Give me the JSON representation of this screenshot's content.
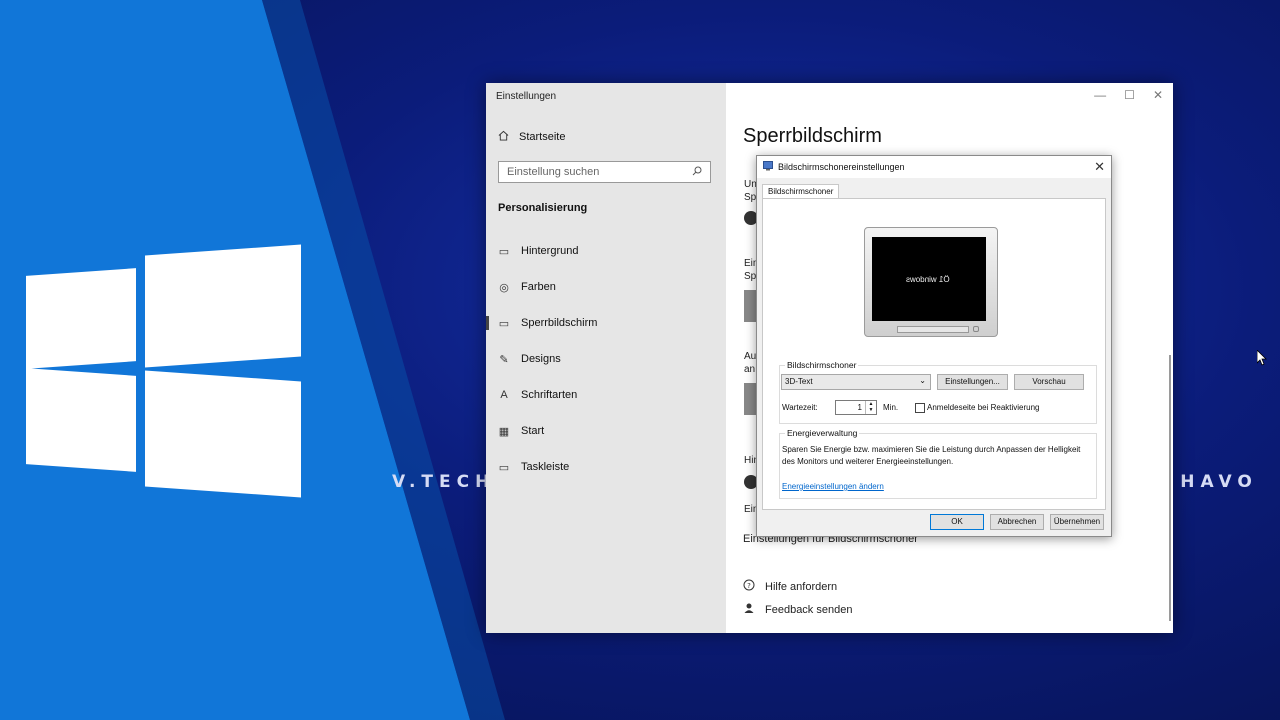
{
  "background": {
    "text_left": "V.TECHN",
    "text_right": "SHAVO",
    "colors": {
      "deep_blue": "#0b1c7a",
      "accent_blue": "#1176d8"
    }
  },
  "settings": {
    "app_title": "Einstellungen",
    "home_label": "Startseite",
    "search_placeholder": "Einstellung suchen",
    "section": "Personalisierung",
    "nav": [
      {
        "label": "Hintergrund",
        "icon": "picture-icon"
      },
      {
        "label": "Farben",
        "icon": "palette-icon"
      },
      {
        "label": "Sperrbildschirm",
        "icon": "lock-screen-icon",
        "active": true
      },
      {
        "label": "Designs",
        "icon": "brush-icon"
      },
      {
        "label": "Schriftarten",
        "icon": "font-icon"
      },
      {
        "label": "Start",
        "icon": "start-icon"
      },
      {
        "label": "Taskleiste",
        "icon": "taskbar-icon"
      }
    ],
    "page_title": "Sperrbildschirm",
    "fragments": [
      "Un",
      "Sp",
      "Ein",
      "Sp",
      "Au",
      "an",
      "Hin",
      "Ein"
    ],
    "screensaver_link": "Einstellungen für Bildschirmschoner",
    "help_label": "Hilfe anfordern",
    "feedback_label": "Feedback senden"
  },
  "dialog": {
    "title": "Bildschirmschonereinstellungen",
    "tab": "Bildschirmschoner",
    "preview_text": "Ö1 windows",
    "group_screensaver": "Bildschirmschoner",
    "selected_screensaver": "3D-Text",
    "settings_button": "Einstellungen...",
    "preview_button": "Vorschau",
    "wait_label": "Wartezeit:",
    "wait_value": "1",
    "wait_unit": "Min.",
    "logon_label": "Anmeldeseite bei Reaktivierung",
    "logon_checked": false,
    "group_energy": "Energieverwaltung",
    "energy_desc": "Sparen Sie Energie bzw. maximieren Sie die Leistung durch Anpassen der Helligkeit des Monitors und weiterer Energieeinstellungen.",
    "energy_link": "Energieeinstellungen ändern",
    "ok": "OK",
    "cancel": "Abbrechen",
    "apply": "Übernehmen"
  }
}
